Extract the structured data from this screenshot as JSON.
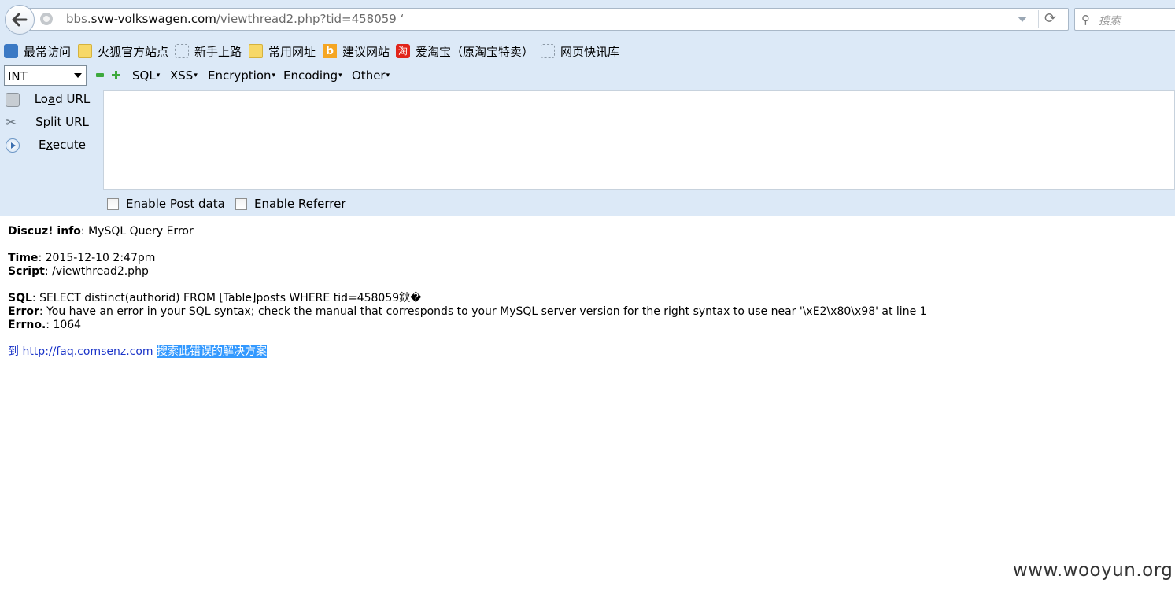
{
  "navbar": {
    "url_prefix": "bbs.",
    "url_domain": "svw-volkswagen.com",
    "url_path": "/viewthread2.php?tid=458059  ‘",
    "search_placeholder": "搜索",
    "back_icon": "back-arrow-icon",
    "reload_glyph": "⟳",
    "search_glyph": "⚲"
  },
  "bookmarks": [
    {
      "label": "最常访问",
      "icon": "most-visited-icon"
    },
    {
      "label": "火狐官方站点",
      "icon": "folder-icon"
    },
    {
      "label": "新手上路",
      "icon": "dashed-page-icon"
    },
    {
      "label": "常用网址",
      "icon": "folder-icon"
    },
    {
      "label": "建议网站",
      "icon": "bing-icon",
      "glyph": "b"
    },
    {
      "label": "爱淘宝（原淘宝特卖）",
      "icon": "taobao-icon",
      "glyph": "淘"
    },
    {
      "label": "网页快讯库",
      "icon": "dashed-page-icon"
    }
  ],
  "hackbar": {
    "select_value": "INT",
    "menus": [
      "SQL",
      "XSS",
      "Encryption",
      "Encoding",
      "Other"
    ],
    "dropdown_glyph": "▾",
    "side_buttons": [
      {
        "pre": "Lo",
        "u": "a",
        "post": "d URL"
      },
      {
        "pre": "",
        "u": "S",
        "post": "plit URL"
      },
      {
        "pre": "E",
        "u": "x",
        "post": "ecute"
      }
    ],
    "split_glyph": "✂",
    "checkboxes": [
      "Enable Post data",
      "Enable Referrer"
    ]
  },
  "content": {
    "info_label": "Discuz! info",
    "info_value": ": MySQL Query Error",
    "time_label": "Time",
    "time_value": ": 2015-12-10 2:47pm",
    "script_label": "Script",
    "script_value": ": /viewthread2.php",
    "sql_label": "SQL",
    "sql_value": ": SELECT distinct(authorid) FROM [Table]posts WHERE tid=458059鈥�",
    "error_label": "Error",
    "error_value": ": You have an error in your SQL syntax; check the manual that corresponds to your MySQL server version for the right syntax to use near '\\xE2\\x80\\x98' at line 1",
    "errno_label": "Errno.",
    "errno_value": ": 1064",
    "faq_link": "到 http://faq.comsenz.com ",
    "faq_selected": "搜索此错误的解决方案"
  },
  "watermark": "www.wooyun.org"
}
